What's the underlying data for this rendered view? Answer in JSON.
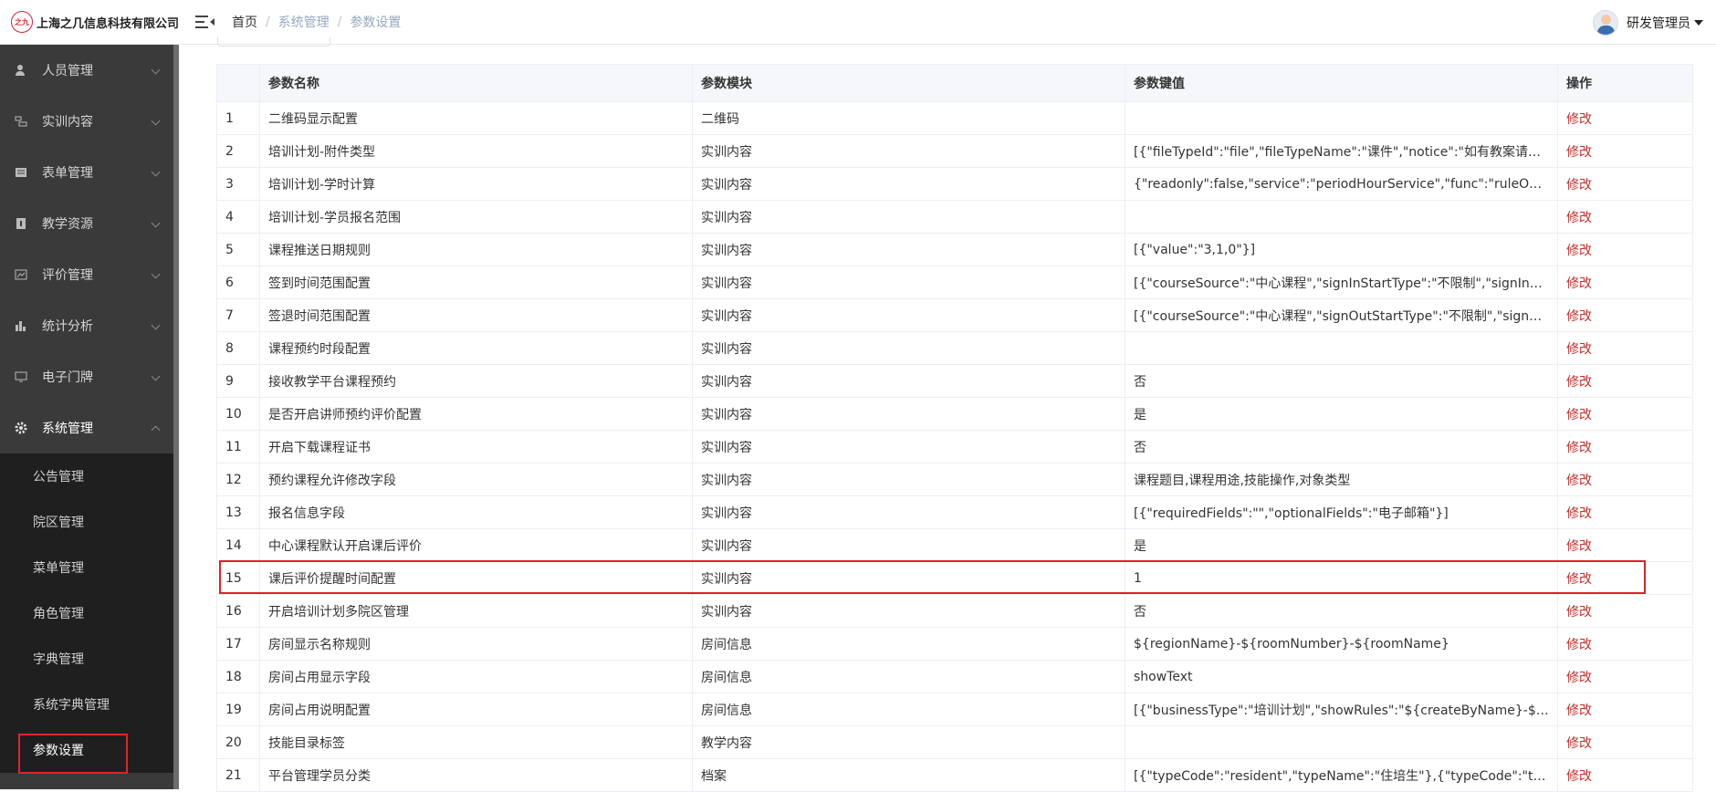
{
  "header": {
    "logo_mark": "之九",
    "company": "上海之几信息科技有限公司",
    "breadcrumb": [
      "首页",
      "系统管理",
      "参数设置"
    ],
    "user_name": "研发管理员"
  },
  "sidebar": {
    "items": [
      {
        "label": "人员管理",
        "icon": "person-icon"
      },
      {
        "label": "实训内容",
        "icon": "training-icon"
      },
      {
        "label": "表单管理",
        "icon": "form-icon"
      },
      {
        "label": "教学资源",
        "icon": "resource-icon"
      },
      {
        "label": "评价管理",
        "icon": "evaluation-icon"
      },
      {
        "label": "统计分析",
        "icon": "bar-chart-icon"
      },
      {
        "label": "电子门牌",
        "icon": "monitor-icon"
      },
      {
        "label": "系统管理",
        "icon": "gear-icon"
      }
    ],
    "sub_items": [
      "公告管理",
      "院区管理",
      "菜单管理",
      "角色管理",
      "字典管理",
      "系统字典管理",
      "参数设置"
    ],
    "active_sub": "参数设置"
  },
  "table": {
    "headers": [
      "",
      "参数名称",
      "参数模块",
      "参数键值",
      "操作"
    ],
    "op_label": "修改",
    "rows": [
      [
        "1",
        "二维码显示配置",
        "二维码",
        ""
      ],
      [
        "2",
        "培训计划-附件类型",
        "实训内容",
        "[{\"fileTypeId\":\"file\",\"fileTypeName\":\"课件\",\"notice\":\"如有教案请上传\",\"fil..."
      ],
      [
        "3",
        "培训计划-学时计算",
        "实训内容",
        "{\"readonly\":false,\"service\":\"periodHourService\",\"func\":\"ruleOne\"}"
      ],
      [
        "4",
        "培训计划-学员报名范围",
        "实训内容",
        ""
      ],
      [
        "5",
        "课程推送日期规则",
        "实训内容",
        "[{\"value\":\"3,1,0\"}]"
      ],
      [
        "6",
        "签到时间范围配置",
        "实训内容",
        "[{\"courseSource\":\"中心课程\",\"signInStartType\":\"不限制\",\"signInStartTi..."
      ],
      [
        "7",
        "签退时间范围配置",
        "实训内容",
        "[{\"courseSource\":\"中心课程\",\"signOutStartType\":\"不限制\",\"signOutStar..."
      ],
      [
        "8",
        "课程预约时段配置",
        "实训内容",
        ""
      ],
      [
        "9",
        "接收教学平台课程预约",
        "实训内容",
        "否"
      ],
      [
        "10",
        "是否开启讲师预约评价配置",
        "实训内容",
        "是"
      ],
      [
        "11",
        "开启下载课程证书",
        "实训内容",
        "否"
      ],
      [
        "12",
        "预约课程允许修改字段",
        "实训内容",
        "课程题目,课程用途,技能操作,对象类型"
      ],
      [
        "13",
        "报名信息字段",
        "实训内容",
        "[{\"requiredFields\":\"\",\"optionalFields\":\"电子邮箱\"}]"
      ],
      [
        "14",
        "中心课程默认开启课后评价",
        "实训内容",
        "是"
      ],
      [
        "15",
        "课后评价提醒时间配置",
        "实训内容",
        "1"
      ],
      [
        "16",
        "开启培训计划多院区管理",
        "实训内容",
        "否"
      ],
      [
        "17",
        "房间显示名称规则",
        "房间信息",
        "${regionName}-${roomNumber}-${roomName}"
      ],
      [
        "18",
        "房间占用显示字段",
        "房间信息",
        "showText"
      ],
      [
        "19",
        "房间占用说明配置",
        "房间信息",
        "[{\"businessType\":\"培训计划\",\"showRules\":\"${createByName}-${course..."
      ],
      [
        "20",
        "技能目录标签",
        "教学内容",
        ""
      ],
      [
        "21",
        "平台管理学员分类",
        "档案",
        "[{\"typeCode\":\"resident\",\"typeName\":\"住培生\"},{\"typeCode\":\"trainee\",\"ty..."
      ]
    ]
  }
}
